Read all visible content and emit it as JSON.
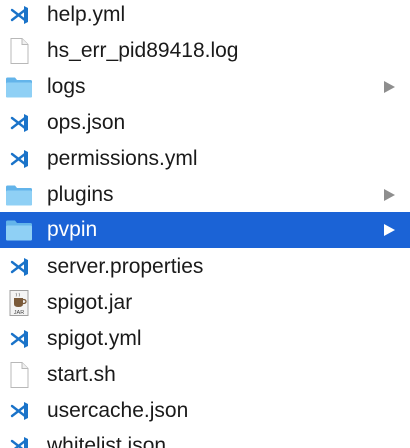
{
  "colors": {
    "selection": "#1b63d6",
    "folder": "#79c6f2",
    "vscode_blue": "#1a73c9",
    "chevron": "#8e8e8e"
  },
  "rows": [
    {
      "name": "help.yml",
      "icon": "vscode-file-icon",
      "kind": "file"
    },
    {
      "name": "hs_err_pid89418.log",
      "icon": "blank-document-icon",
      "kind": "file"
    },
    {
      "name": "logs",
      "icon": "folder-icon",
      "kind": "folder"
    },
    {
      "name": "ops.json",
      "icon": "vscode-file-icon",
      "kind": "file"
    },
    {
      "name": "permissions.yml",
      "icon": "vscode-file-icon",
      "kind": "file"
    },
    {
      "name": "plugins",
      "icon": "folder-icon",
      "kind": "folder"
    },
    {
      "name": "pvpin",
      "icon": "folder-icon",
      "kind": "folder",
      "selected": true
    },
    {
      "name": "server.properties",
      "icon": "vscode-file-icon",
      "kind": "file"
    },
    {
      "name": "spigot.jar",
      "icon": "jar-file-icon",
      "kind": "file",
      "icon_text": "JAR"
    },
    {
      "name": "spigot.yml",
      "icon": "vscode-file-icon",
      "kind": "file"
    },
    {
      "name": "start.sh",
      "icon": "blank-document-icon",
      "kind": "file"
    },
    {
      "name": "usercache.json",
      "icon": "vscode-file-icon",
      "kind": "file"
    },
    {
      "name": "whitelist.json",
      "icon": "vscode-file-icon",
      "kind": "file"
    }
  ]
}
